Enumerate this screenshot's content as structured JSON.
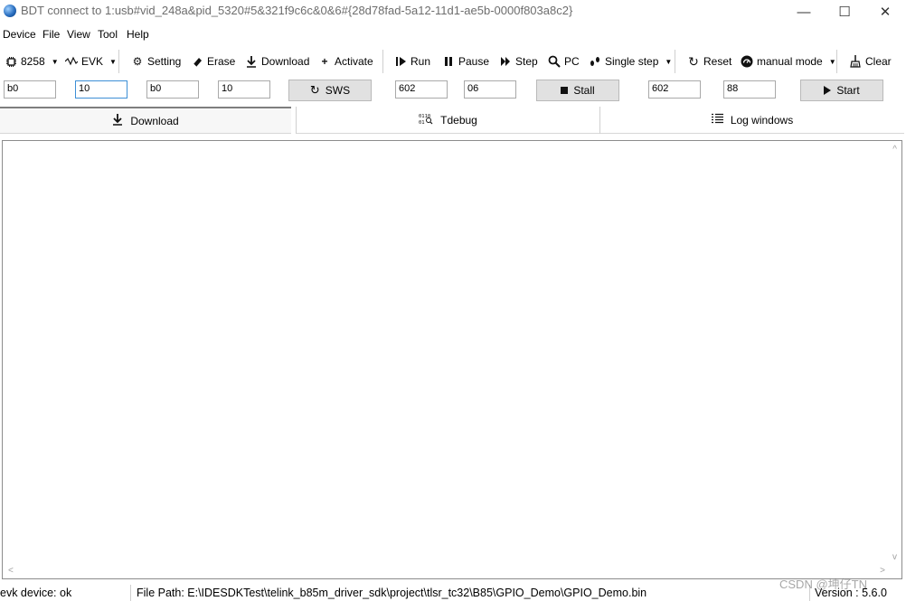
{
  "window": {
    "title": "BDT connect to 1:usb#vid_248a&pid_5320#5&321f9c6c&0&6#{28d78fad-5a12-11d1-ae5b-0000f803a8c2}",
    "minimize": "—",
    "maximize": "☐",
    "close": "✕"
  },
  "menu": [
    "Device",
    "File",
    "View",
    "Tool",
    "Help"
  ],
  "toolbar": {
    "chip": "8258",
    "board": "EVK",
    "setting": "Setting",
    "erase": "Erase",
    "download": "Download",
    "activate": "Activate",
    "run": "Run",
    "pause": "Pause",
    "step": "Step",
    "pc": "PC",
    "single_step": "Single step",
    "reset": "Reset",
    "manual_mode": "manual mode",
    "clear": "Clear"
  },
  "params": {
    "field1": "b0",
    "field2": "10",
    "field3": "b0",
    "field4": "10",
    "sws_button": "SWS",
    "field5": "602",
    "field6": "06",
    "stall_button": "Stall",
    "field7": "602",
    "field8": "88",
    "start_button": "Start"
  },
  "tabs": [
    "Download",
    "Tdebug",
    "Log windows"
  ],
  "status": {
    "device": "evk device: ok",
    "file_path": "File Path:  E:\\IDESDKTest\\telink_b85m_driver_sdk\\project\\tlsr_tc32\\B85\\GPIO_Demo\\GPIO_Demo.bin",
    "version": "Version : 5.6.0",
    "watermark": "CSDN @坤仔TN"
  },
  "colors": {
    "focus_border": "#3d8fd6",
    "button_bg": "#e1e1e1",
    "title_text": "#6d6d6d"
  }
}
